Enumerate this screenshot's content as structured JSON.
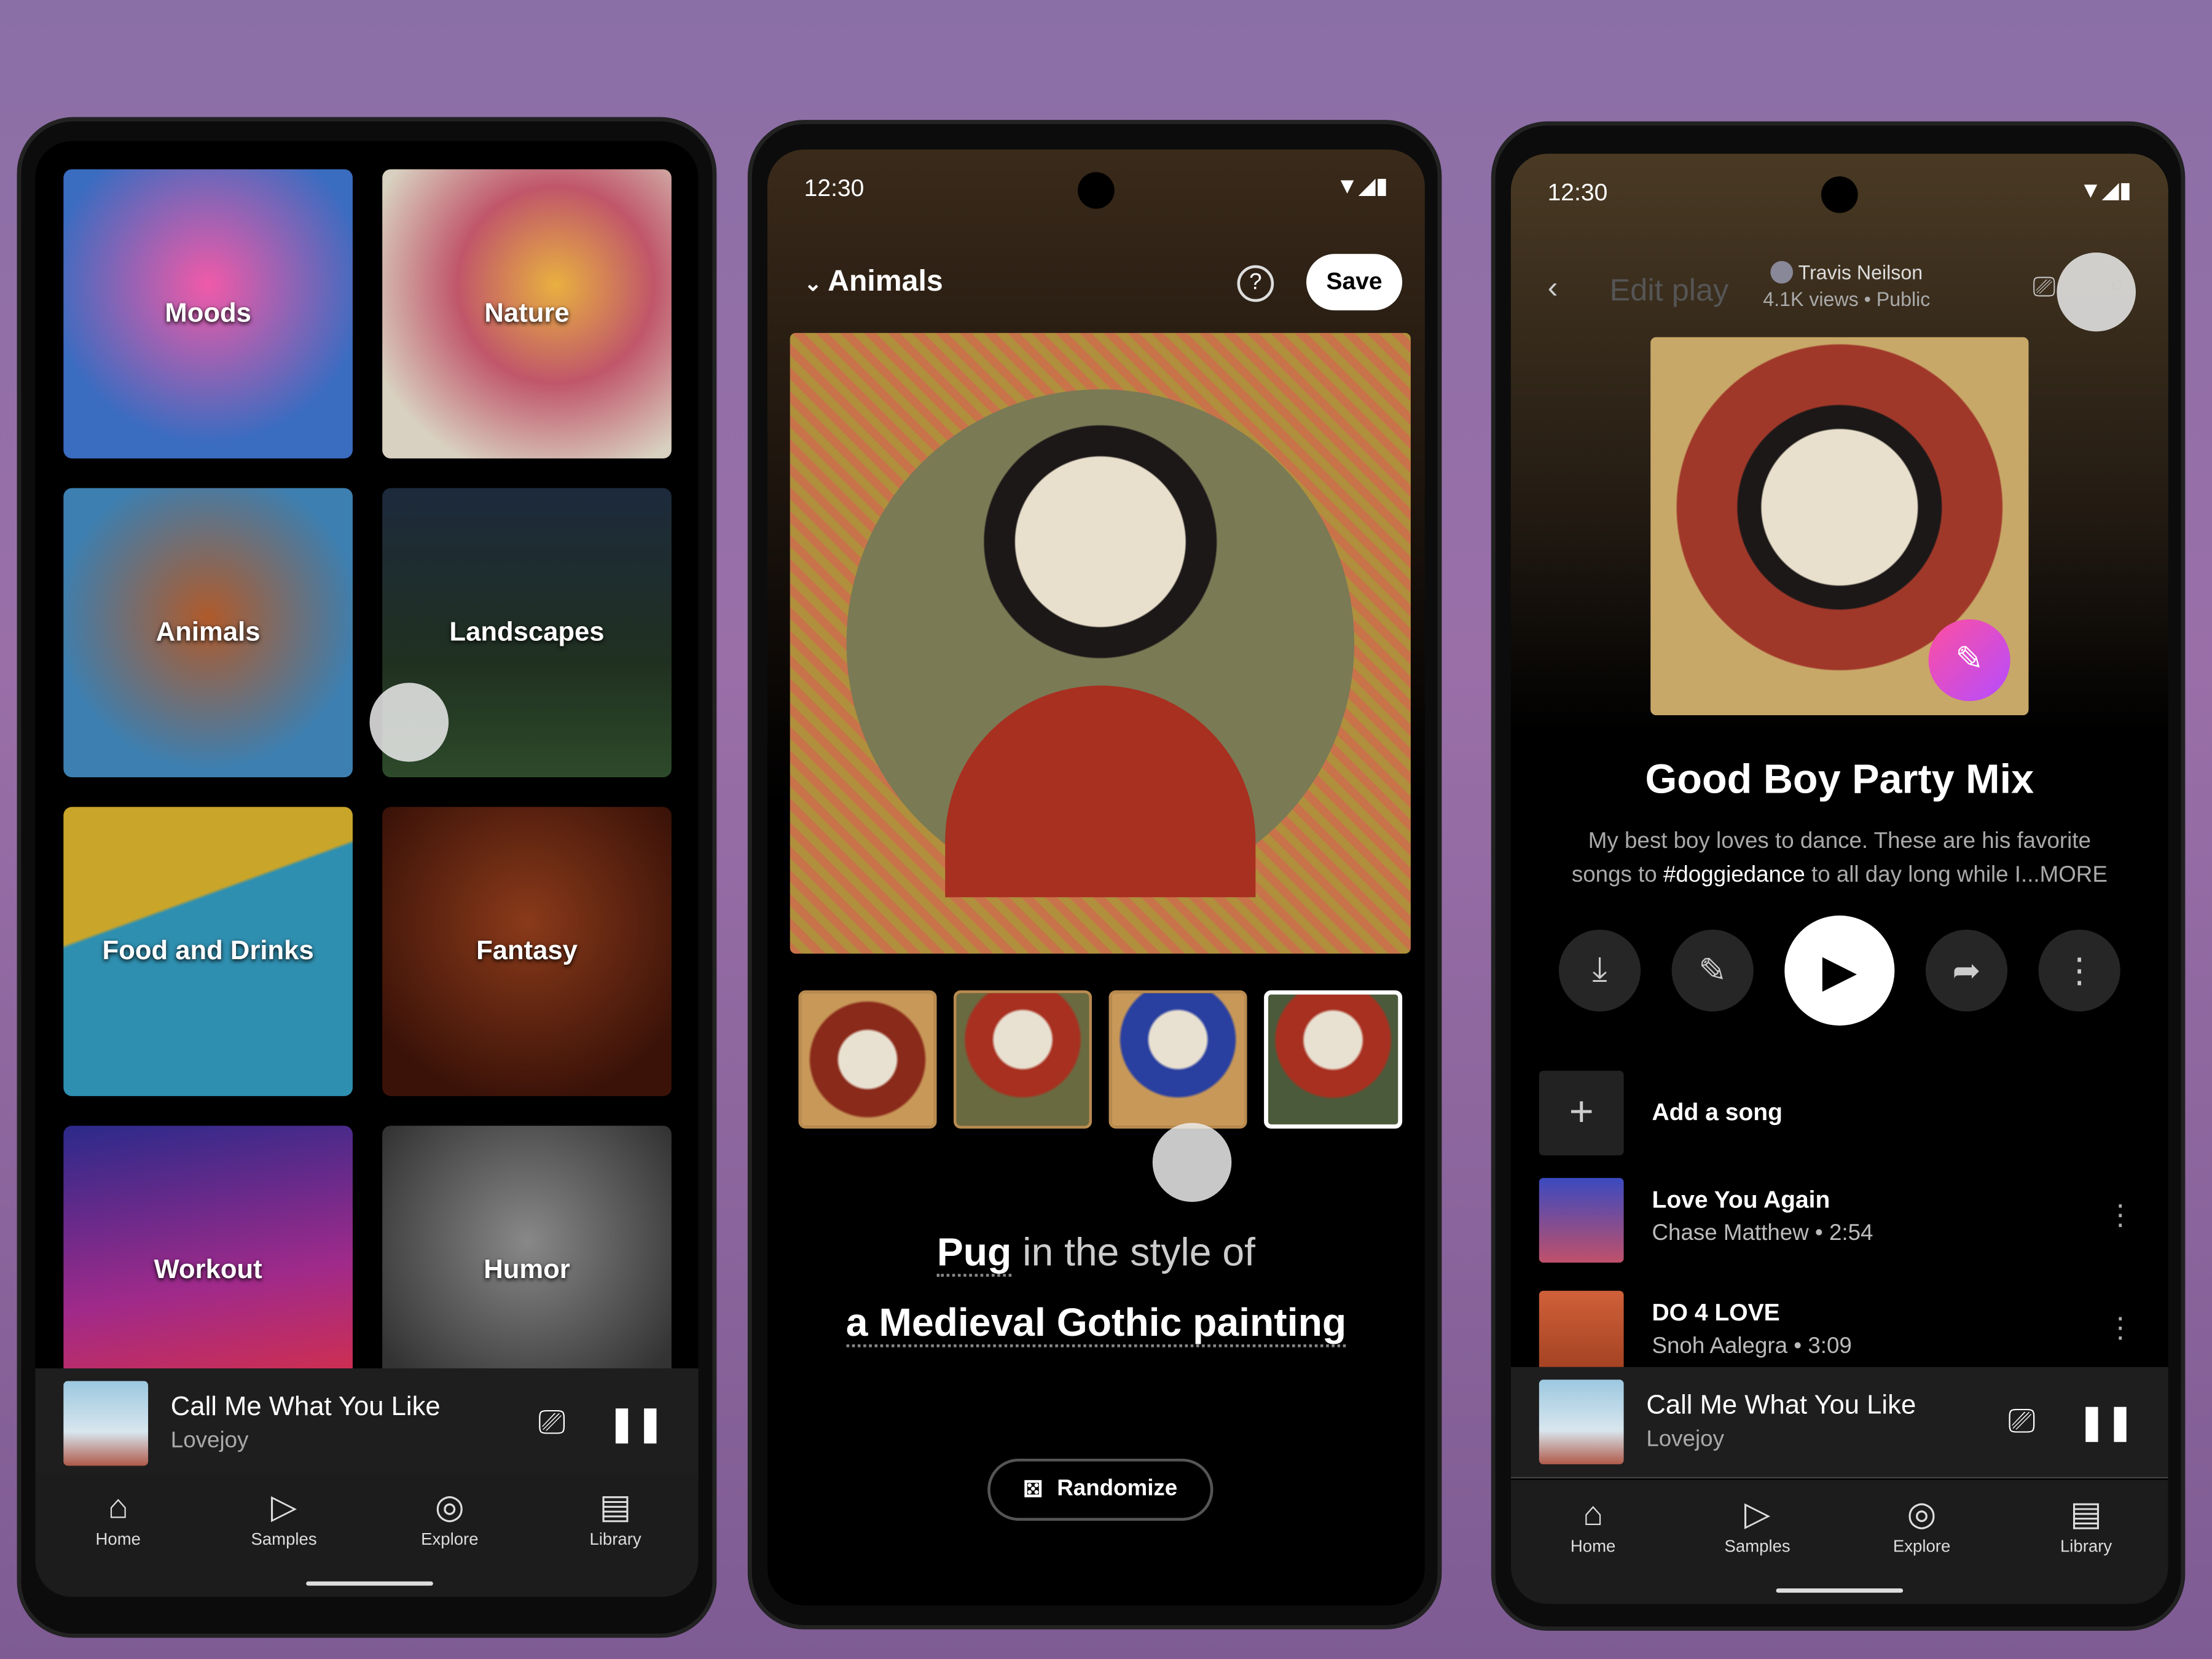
{
  "status": {
    "time": "12:30"
  },
  "screen1": {
    "categories": [
      "Moods",
      "Nature",
      "Animals",
      "Landscapes",
      "Food and Drinks",
      "Fantasy",
      "Workout",
      "Humor"
    ]
  },
  "screen2": {
    "title": "Animals",
    "help_icon": "help-circle-icon",
    "save": "Save",
    "prompt_subject": "Pug",
    "prompt_mid": "in the style of",
    "prompt_style": "a Medieval Gothic painting",
    "randomize": "Randomize",
    "selected_thumb": 4
  },
  "screen3": {
    "edit_title": "Edit play",
    "owner": "Travis Neilson",
    "meta": "4.1K views  •  Public",
    "title": "Good Boy Party Mix",
    "desc_1": "My best boy loves to dance. These are his favorite",
    "desc_2a": "songs to ",
    "desc_hashtag": "#doggiedance",
    "desc_2b": " to all day long while I...",
    "desc_more": "MORE",
    "add_song": "Add a song",
    "songs": [
      {
        "title": "Love You Again",
        "sub": "Chase Matthew • 2:54"
      },
      {
        "title": "DO 4 LOVE",
        "sub": "Snoh Aalegra • 3:09"
      }
    ]
  },
  "mini_player": {
    "title": "Call Me What You Like",
    "artist": "Lovejoy"
  },
  "nav": [
    "Home",
    "Samples",
    "Explore",
    "Library"
  ],
  "colors": {
    "accent_gradient_start": "#ff4fa0",
    "accent_gradient_end": "#b44cff",
    "background": "#8a6fa6"
  }
}
